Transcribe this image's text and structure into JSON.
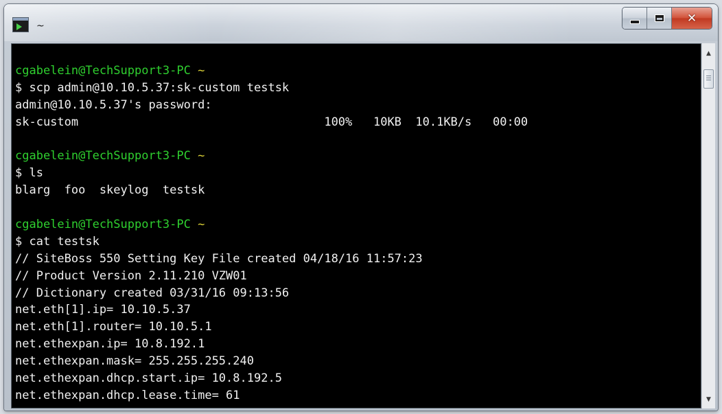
{
  "window": {
    "title": "~",
    "icon": "terminal-icon",
    "buttons": {
      "minimize": "minimize-icon",
      "maximize": "maximize-icon",
      "close": "✕"
    }
  },
  "terminal": {
    "colors": {
      "background": "#000000",
      "text": "#f1f1f1",
      "user": "#2fcf2f",
      "path": "#d9cf35"
    },
    "lines": [
      {
        "kind": "prompt",
        "user": "cgabelein@TechSupport3-PC",
        "path": "~"
      },
      {
        "kind": "text",
        "text": "$ scp admin@10.10.5.37:sk-custom testsk"
      },
      {
        "kind": "text",
        "text": "admin@10.10.5.37's password:"
      },
      {
        "kind": "text",
        "text": "sk-custom                                   100%   10KB  10.1KB/s   00:00"
      },
      {
        "kind": "blank",
        "text": ""
      },
      {
        "kind": "prompt",
        "user": "cgabelein@TechSupport3-PC",
        "path": "~"
      },
      {
        "kind": "text",
        "text": "$ ls"
      },
      {
        "kind": "text",
        "text": "blarg  foo  skeylog  testsk"
      },
      {
        "kind": "blank",
        "text": ""
      },
      {
        "kind": "prompt",
        "user": "cgabelein@TechSupport3-PC",
        "path": "~"
      },
      {
        "kind": "text",
        "text": "$ cat testsk"
      },
      {
        "kind": "text",
        "text": "// SiteBoss 550 Setting Key File created 04/18/16 11:57:23"
      },
      {
        "kind": "text",
        "text": "// Product Version 2.11.210 VZW01"
      },
      {
        "kind": "text",
        "text": "// Dictionary created 03/31/16 09:13:56"
      },
      {
        "kind": "text",
        "text": "net.eth[1].ip= 10.10.5.37"
      },
      {
        "kind": "text",
        "text": "net.eth[1].router= 10.10.5.1"
      },
      {
        "kind": "text",
        "text": "net.ethexpan.ip= 10.8.192.1"
      },
      {
        "kind": "text",
        "text": "net.ethexpan.mask= 255.255.255.240"
      },
      {
        "kind": "text",
        "text": "net.ethexpan.dhcp.start.ip= 10.8.192.5"
      },
      {
        "kind": "text",
        "text": "net.ethexpan.dhcp.lease.time= 61"
      }
    ]
  },
  "scrollbar": {
    "up_icon": "▲",
    "down_icon": "▼"
  }
}
